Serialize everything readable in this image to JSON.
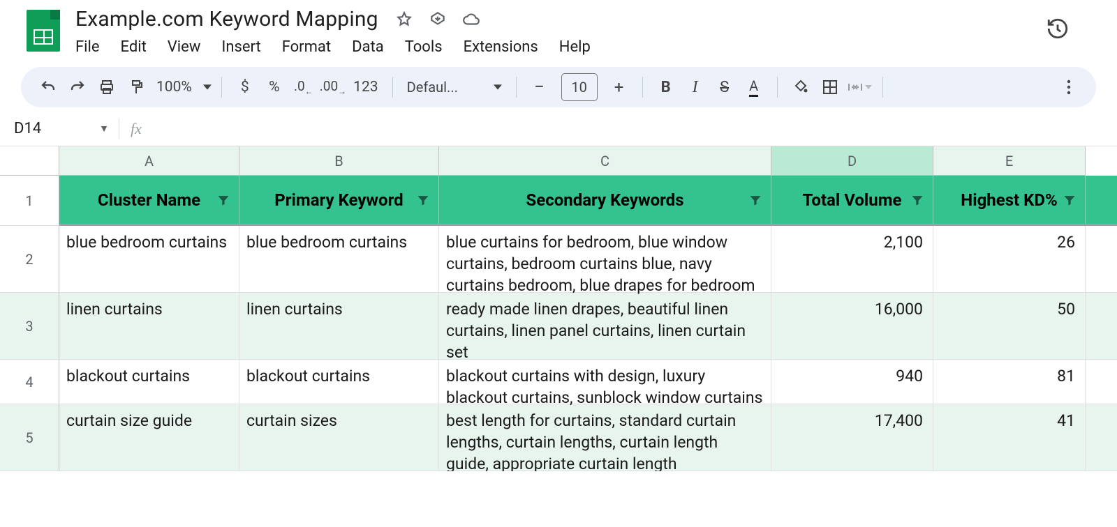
{
  "header": {
    "title": "Example.com Keyword Mapping",
    "menus": [
      "File",
      "Edit",
      "View",
      "Insert",
      "Format",
      "Data",
      "Tools",
      "Extensions",
      "Help"
    ]
  },
  "toolbar": {
    "zoom": "100%",
    "currency": "$",
    "percent": "%",
    "dec_less": ".0",
    "dec_more": ".00",
    "num123": "123",
    "font": "Defaul...",
    "font_size": "10",
    "bold": "B",
    "italic": "I",
    "minus": "−",
    "plus": "+"
  },
  "namebox": {
    "ref": "D14"
  },
  "columns": [
    "A",
    "B",
    "C",
    "D",
    "E"
  ],
  "selected_col": "D",
  "table": {
    "headers": [
      "Cluster Name",
      "Primary Keyword",
      "Secondary Keywords",
      "Total Volume",
      "Highest KD%"
    ],
    "rows": [
      {
        "cluster": "blue bedroom curtains",
        "primary": "blue bedroom curtains",
        "secondary": "blue curtains for bedroom, blue window curtains, bedroom curtains blue, navy curtains bedroom, blue drapes for bedroom",
        "volume": "2,100",
        "kd": "26"
      },
      {
        "cluster": "linen curtains",
        "primary": "linen curtains",
        "secondary": "ready made linen drapes, beautiful linen curtains, linen panel curtains, linen curtain set",
        "volume": "16,000",
        "kd": "50"
      },
      {
        "cluster": "blackout curtains",
        "primary": "blackout curtains",
        "secondary": "blackout curtains with design, luxury blackout curtains, sunblock window curtains",
        "volume": "940",
        "kd": "81"
      },
      {
        "cluster": "curtain size guide",
        "primary": "curtain sizes",
        "secondary": "best length for curtains, standard curtain lengths, curtain lengths, curtain length guide, appropriate curtain length",
        "volume": "17,400",
        "kd": "41"
      }
    ]
  },
  "row_numbers": [
    "1",
    "2",
    "3",
    "4",
    "5"
  ]
}
